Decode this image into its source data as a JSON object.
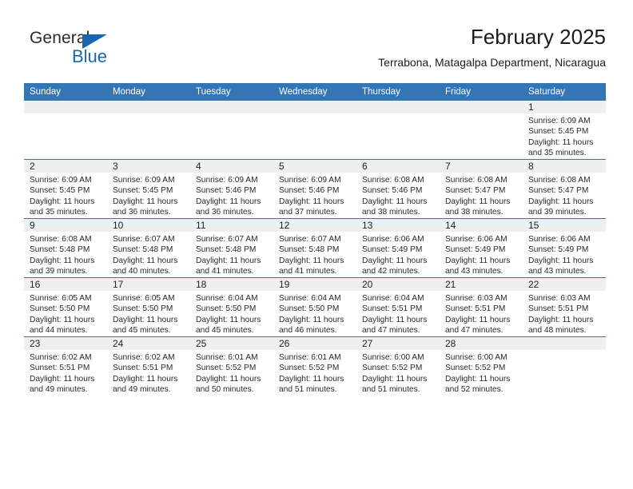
{
  "logo": {
    "word_top": "General",
    "word_bottom": "Blue",
    "triangle_color": "#1567b2",
    "text_color": "#2b2b2b"
  },
  "header": {
    "title": "February 2025",
    "subtitle": "Terrabona, Matagalpa Department, Nicaragua"
  },
  "theme": {
    "header_blue": "#3375b5",
    "daynum_strip": "#efefef",
    "cell_background": "#ffffff",
    "text_color": "#2a2a2a"
  },
  "weekdays": [
    "Sunday",
    "Monday",
    "Tuesday",
    "Wednesday",
    "Thursday",
    "Friday",
    "Saturday"
  ],
  "weeks": [
    [
      {
        "day": "",
        "sunrise": "",
        "sunset": "",
        "daylight": "",
        "empty": true
      },
      {
        "day": "",
        "sunrise": "",
        "sunset": "",
        "daylight": "",
        "empty": true
      },
      {
        "day": "",
        "sunrise": "",
        "sunset": "",
        "daylight": "",
        "empty": true
      },
      {
        "day": "",
        "sunrise": "",
        "sunset": "",
        "daylight": "",
        "empty": true
      },
      {
        "day": "",
        "sunrise": "",
        "sunset": "",
        "daylight": "",
        "empty": true
      },
      {
        "day": "",
        "sunrise": "",
        "sunset": "",
        "daylight": "",
        "empty": true
      },
      {
        "day": "1",
        "sunrise": "Sunrise: 6:09 AM",
        "sunset": "Sunset: 5:45 PM",
        "daylight": "Daylight: 11 hours and 35 minutes."
      }
    ],
    [
      {
        "day": "2",
        "sunrise": "Sunrise: 6:09 AM",
        "sunset": "Sunset: 5:45 PM",
        "daylight": "Daylight: 11 hours and 35 minutes."
      },
      {
        "day": "3",
        "sunrise": "Sunrise: 6:09 AM",
        "sunset": "Sunset: 5:45 PM",
        "daylight": "Daylight: 11 hours and 36 minutes."
      },
      {
        "day": "4",
        "sunrise": "Sunrise: 6:09 AM",
        "sunset": "Sunset: 5:46 PM",
        "daylight": "Daylight: 11 hours and 36 minutes."
      },
      {
        "day": "5",
        "sunrise": "Sunrise: 6:09 AM",
        "sunset": "Sunset: 5:46 PM",
        "daylight": "Daylight: 11 hours and 37 minutes."
      },
      {
        "day": "6",
        "sunrise": "Sunrise: 6:08 AM",
        "sunset": "Sunset: 5:46 PM",
        "daylight": "Daylight: 11 hours and 38 minutes."
      },
      {
        "day": "7",
        "sunrise": "Sunrise: 6:08 AM",
        "sunset": "Sunset: 5:47 PM",
        "daylight": "Daylight: 11 hours and 38 minutes."
      },
      {
        "day": "8",
        "sunrise": "Sunrise: 6:08 AM",
        "sunset": "Sunset: 5:47 PM",
        "daylight": "Daylight: 11 hours and 39 minutes."
      }
    ],
    [
      {
        "day": "9",
        "sunrise": "Sunrise: 6:08 AM",
        "sunset": "Sunset: 5:48 PM",
        "daylight": "Daylight: 11 hours and 39 minutes."
      },
      {
        "day": "10",
        "sunrise": "Sunrise: 6:07 AM",
        "sunset": "Sunset: 5:48 PM",
        "daylight": "Daylight: 11 hours and 40 minutes."
      },
      {
        "day": "11",
        "sunrise": "Sunrise: 6:07 AM",
        "sunset": "Sunset: 5:48 PM",
        "daylight": "Daylight: 11 hours and 41 minutes."
      },
      {
        "day": "12",
        "sunrise": "Sunrise: 6:07 AM",
        "sunset": "Sunset: 5:48 PM",
        "daylight": "Daylight: 11 hours and 41 minutes."
      },
      {
        "day": "13",
        "sunrise": "Sunrise: 6:06 AM",
        "sunset": "Sunset: 5:49 PM",
        "daylight": "Daylight: 11 hours and 42 minutes."
      },
      {
        "day": "14",
        "sunrise": "Sunrise: 6:06 AM",
        "sunset": "Sunset: 5:49 PM",
        "daylight": "Daylight: 11 hours and 43 minutes."
      },
      {
        "day": "15",
        "sunrise": "Sunrise: 6:06 AM",
        "sunset": "Sunset: 5:49 PM",
        "daylight": "Daylight: 11 hours and 43 minutes."
      }
    ],
    [
      {
        "day": "16",
        "sunrise": "Sunrise: 6:05 AM",
        "sunset": "Sunset: 5:50 PM",
        "daylight": "Daylight: 11 hours and 44 minutes."
      },
      {
        "day": "17",
        "sunrise": "Sunrise: 6:05 AM",
        "sunset": "Sunset: 5:50 PM",
        "daylight": "Daylight: 11 hours and 45 minutes."
      },
      {
        "day": "18",
        "sunrise": "Sunrise: 6:04 AM",
        "sunset": "Sunset: 5:50 PM",
        "daylight": "Daylight: 11 hours and 45 minutes."
      },
      {
        "day": "19",
        "sunrise": "Sunrise: 6:04 AM",
        "sunset": "Sunset: 5:50 PM",
        "daylight": "Daylight: 11 hours and 46 minutes."
      },
      {
        "day": "20",
        "sunrise": "Sunrise: 6:04 AM",
        "sunset": "Sunset: 5:51 PM",
        "daylight": "Daylight: 11 hours and 47 minutes."
      },
      {
        "day": "21",
        "sunrise": "Sunrise: 6:03 AM",
        "sunset": "Sunset: 5:51 PM",
        "daylight": "Daylight: 11 hours and 47 minutes."
      },
      {
        "day": "22",
        "sunrise": "Sunrise: 6:03 AM",
        "sunset": "Sunset: 5:51 PM",
        "daylight": "Daylight: 11 hours and 48 minutes."
      }
    ],
    [
      {
        "day": "23",
        "sunrise": "Sunrise: 6:02 AM",
        "sunset": "Sunset: 5:51 PM",
        "daylight": "Daylight: 11 hours and 49 minutes."
      },
      {
        "day": "24",
        "sunrise": "Sunrise: 6:02 AM",
        "sunset": "Sunset: 5:51 PM",
        "daylight": "Daylight: 11 hours and 49 minutes."
      },
      {
        "day": "25",
        "sunrise": "Sunrise: 6:01 AM",
        "sunset": "Sunset: 5:52 PM",
        "daylight": "Daylight: 11 hours and 50 minutes."
      },
      {
        "day": "26",
        "sunrise": "Sunrise: 6:01 AM",
        "sunset": "Sunset: 5:52 PM",
        "daylight": "Daylight: 11 hours and 51 minutes."
      },
      {
        "day": "27",
        "sunrise": "Sunrise: 6:00 AM",
        "sunset": "Sunset: 5:52 PM",
        "daylight": "Daylight: 11 hours and 51 minutes."
      },
      {
        "day": "28",
        "sunrise": "Sunrise: 6:00 AM",
        "sunset": "Sunset: 5:52 PM",
        "daylight": "Daylight: 11 hours and 52 minutes."
      },
      {
        "day": "",
        "sunrise": "",
        "sunset": "",
        "daylight": "",
        "empty": true
      }
    ]
  ]
}
